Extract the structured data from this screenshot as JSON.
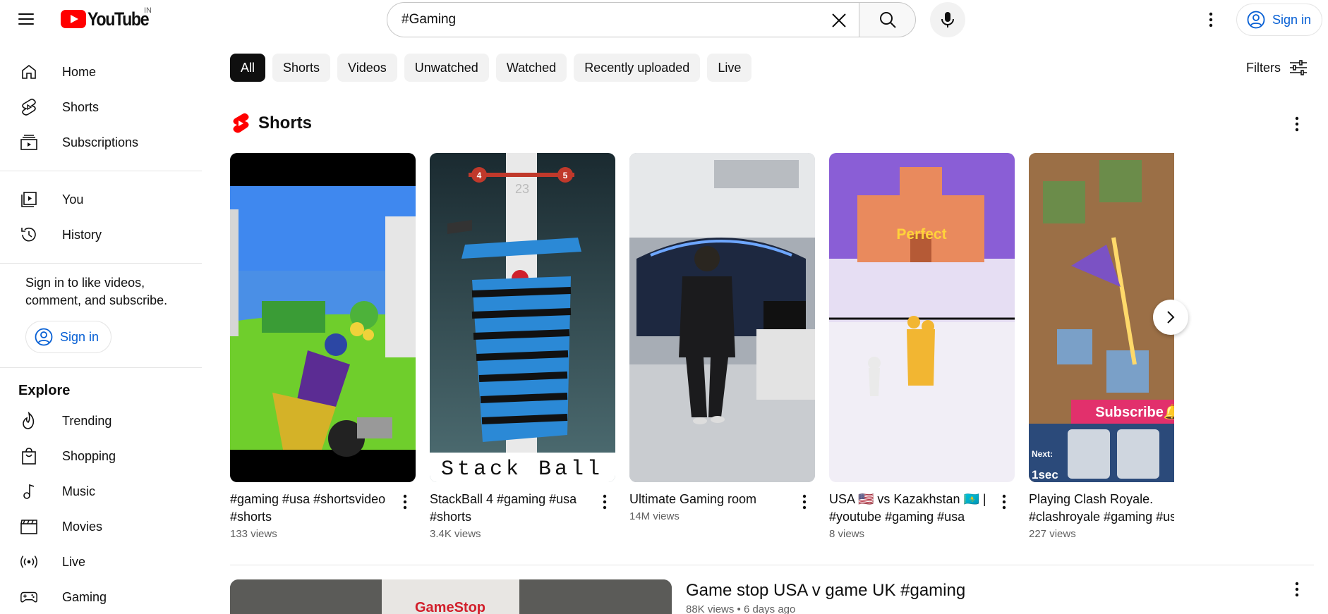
{
  "masthead": {
    "logo_text": "YouTube",
    "country_code": "IN",
    "search_value": "#Gaming",
    "signin_label": "Sign in"
  },
  "sidebar": {
    "main": [
      {
        "label": "Home",
        "icon": "home-icon"
      },
      {
        "label": "Shorts",
        "icon": "shorts-icon"
      },
      {
        "label": "Subscriptions",
        "icon": "subscriptions-icon"
      }
    ],
    "you": [
      {
        "label": "You",
        "icon": "you-icon"
      },
      {
        "label": "History",
        "icon": "history-icon"
      }
    ],
    "signin_prompt": "Sign in to like videos, comment, and subscribe.",
    "signin_label": "Sign in",
    "explore_title": "Explore",
    "explore": [
      {
        "label": "Trending",
        "icon": "trending-icon"
      },
      {
        "label": "Shopping",
        "icon": "shopping-icon"
      },
      {
        "label": "Music",
        "icon": "music-icon"
      },
      {
        "label": "Movies",
        "icon": "movies-icon"
      },
      {
        "label": "Live",
        "icon": "live-icon"
      },
      {
        "label": "Gaming",
        "icon": "gaming-icon"
      }
    ]
  },
  "chips": [
    "All",
    "Shorts",
    "Videos",
    "Unwatched",
    "Watched",
    "Recently uploaded",
    "Live"
  ],
  "filters_label": "Filters",
  "shorts_shelf": {
    "title": "Shorts",
    "items": [
      {
        "title": "#gaming #usa #shortsvideo #shorts",
        "views": "133 views"
      },
      {
        "title": "StackBall 4 #gaming #usa #shorts",
        "views": "3.4K views",
        "overlay_text": "Stack Ball",
        "score_left": "4",
        "score_right": "5",
        "score_mid": "23"
      },
      {
        "title": "Ultimate Gaming room",
        "views": "14M views"
      },
      {
        "title": "USA 🇺🇸 vs Kazakhstan 🇰🇿 | #youtube #gaming #usa",
        "views": "8 views",
        "overlay_text": "Perfect"
      },
      {
        "title": "Playing Clash Royale. #clashroyale #gaming #us",
        "views": "227 views",
        "overlay_text": "Subscribe🔔",
        "overlay_next": "Next:",
        "overlay_timer": "1sec"
      }
    ]
  },
  "video": {
    "title": "Game stop USA v game UK #gaming",
    "meta": "88K views • 6 days ago",
    "thumb_sign": "GameStop"
  },
  "colors": {
    "brand_red": "#ff0000",
    "link_blue": "#065fd4",
    "chip_bg": "#f2f2f2",
    "chip_active_bg": "#0f0f0f"
  }
}
